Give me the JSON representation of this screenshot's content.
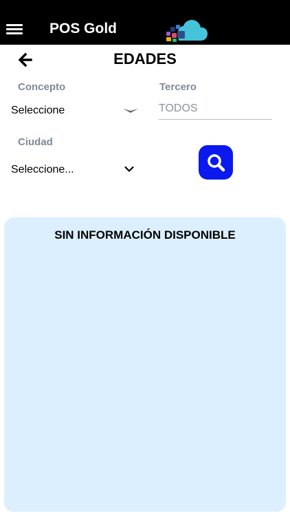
{
  "header": {
    "app_title": "POS Gold",
    "menu_icon": "hamburger-menu-icon",
    "logo_icon": "cloud-logo-icon"
  },
  "page": {
    "title": "EDADES",
    "back_icon": "arrow-left-icon"
  },
  "filters": {
    "concepto": {
      "label": "Concepto",
      "value": "Seleccione",
      "icon": "caret-down-icon"
    },
    "tercero": {
      "label": "Tercero",
      "value": "",
      "placeholder": "TODOS"
    },
    "ciudad": {
      "label": "Ciudad",
      "value": "Seleccione...",
      "icon": "chevron-down-icon"
    },
    "search_icon": "magnifier-icon"
  },
  "results": {
    "message": "SIN INFORMACIÓN DISPONIBLE"
  },
  "colors": {
    "header_bg": "#000000",
    "search_button": "#0a1aee",
    "panel_bg": "#dcefff",
    "label_gray": "#808a97"
  }
}
